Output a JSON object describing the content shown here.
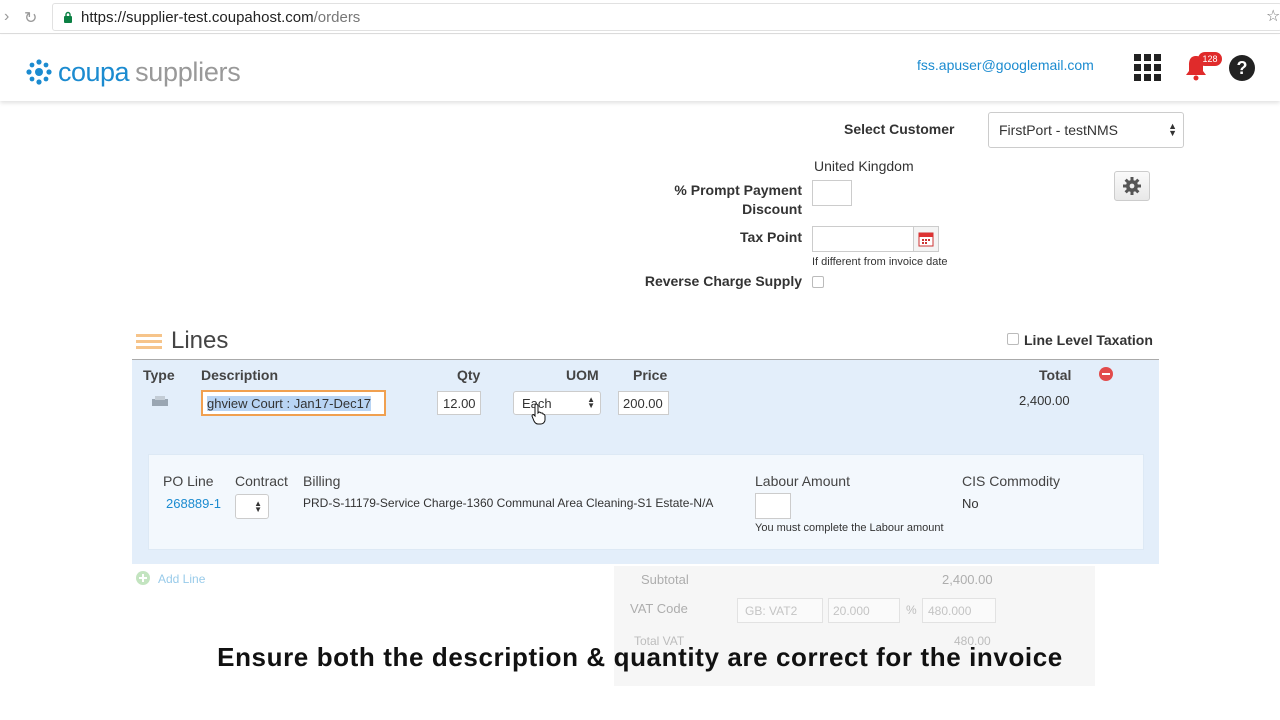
{
  "browser": {
    "url_host": "https://supplier-test.coupahost.com",
    "url_path": "/orders"
  },
  "header": {
    "logo_primary": "coupa",
    "logo_secondary": "suppliers",
    "user_email": "fss.apuser@googlemail.com",
    "notifications_count": "128",
    "icons": [
      "apps-grid-icon",
      "bell-icon",
      "help-icon"
    ]
  },
  "form": {
    "select_customer_label": "Select Customer",
    "customer_value": "FirstPort - testNMS",
    "country": "United Kingdom",
    "prompt_payment_label": "% Prompt Payment Discount",
    "tax_point_label": "Tax Point",
    "tax_point_hint": "If different from invoice date",
    "reverse_charge_label": "Reverse Charge Supply"
  },
  "lines": {
    "title": "Lines",
    "line_level_taxation_label": "Line Level Taxation",
    "columns": {
      "type": "Type",
      "description": "Description",
      "qty": "Qty",
      "uom": "UOM",
      "price": "Price",
      "total": "Total"
    },
    "row": {
      "description": "ghview Court : Jan17-Dec17",
      "qty": "12.00",
      "uom": "Each",
      "price": "200.00",
      "total": "2,400.00"
    },
    "details": {
      "po_line_label": "PO Line",
      "contract_label": "Contract",
      "billing_label": "Billing",
      "labour_amount_label": "Labour Amount",
      "cis_label": "CIS Commodity",
      "po_line_value": "268889-1",
      "billing_value": "PRD-S-11179-Service Charge-1360 Communal Area Cleaning-S1 Estate-N/A",
      "labour_hint": "You must complete the Labour amount",
      "cis_value": "No"
    },
    "add_line_label": "Add Line"
  },
  "totals": {
    "subtotal_label": "Subtotal",
    "subtotal_value": "2,400.00",
    "vat_code_label": "VAT Code",
    "vat_code_value": "GB: VAT2",
    "vat_rate": "20.000",
    "percent_sign": "%",
    "vat_amount": "480.000",
    "total_vat_label": "Total VAT",
    "total_vat_value": "480.00"
  },
  "caption": "Ensure both the description & quantity are correct for the invoice",
  "colors": {
    "brand_blue": "#1b8bd0",
    "badge_red": "#e02b2b",
    "panel_blue": "#e3eefa"
  }
}
